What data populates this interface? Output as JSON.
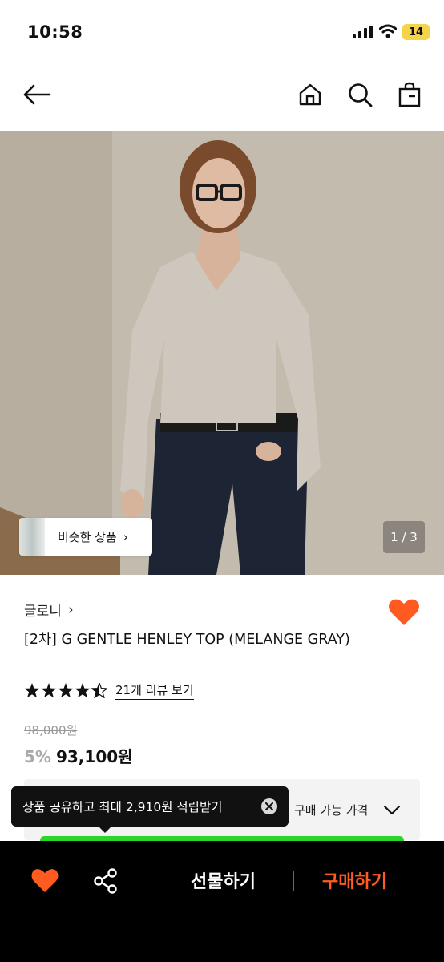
{
  "status_bar": {
    "time": "10:58",
    "battery": "14"
  },
  "gallery": {
    "similar_label": "비슷한 상품",
    "page_counter": "1 / 3"
  },
  "product": {
    "brand": "글로니",
    "title": "[2차] G GENTLE HENLEY TOP (MELANGE GRAY)",
    "rating": 4.5,
    "review_link": "21개 리뷰 보기",
    "original_price": "98,000원",
    "discount": "5%",
    "final_price": "93,100원"
  },
  "price_box": {
    "label": "구매 가능 가격"
  },
  "tooltip": {
    "text": "상품 공유하고 최대 2,910원 적립받기"
  },
  "bottom_bar": {
    "gift_label": "선물하기",
    "buy_label": "구매하기"
  },
  "colors": {
    "accent": "#ff5a1f",
    "green": "#2bd62b",
    "battery": "#f4d44a"
  }
}
